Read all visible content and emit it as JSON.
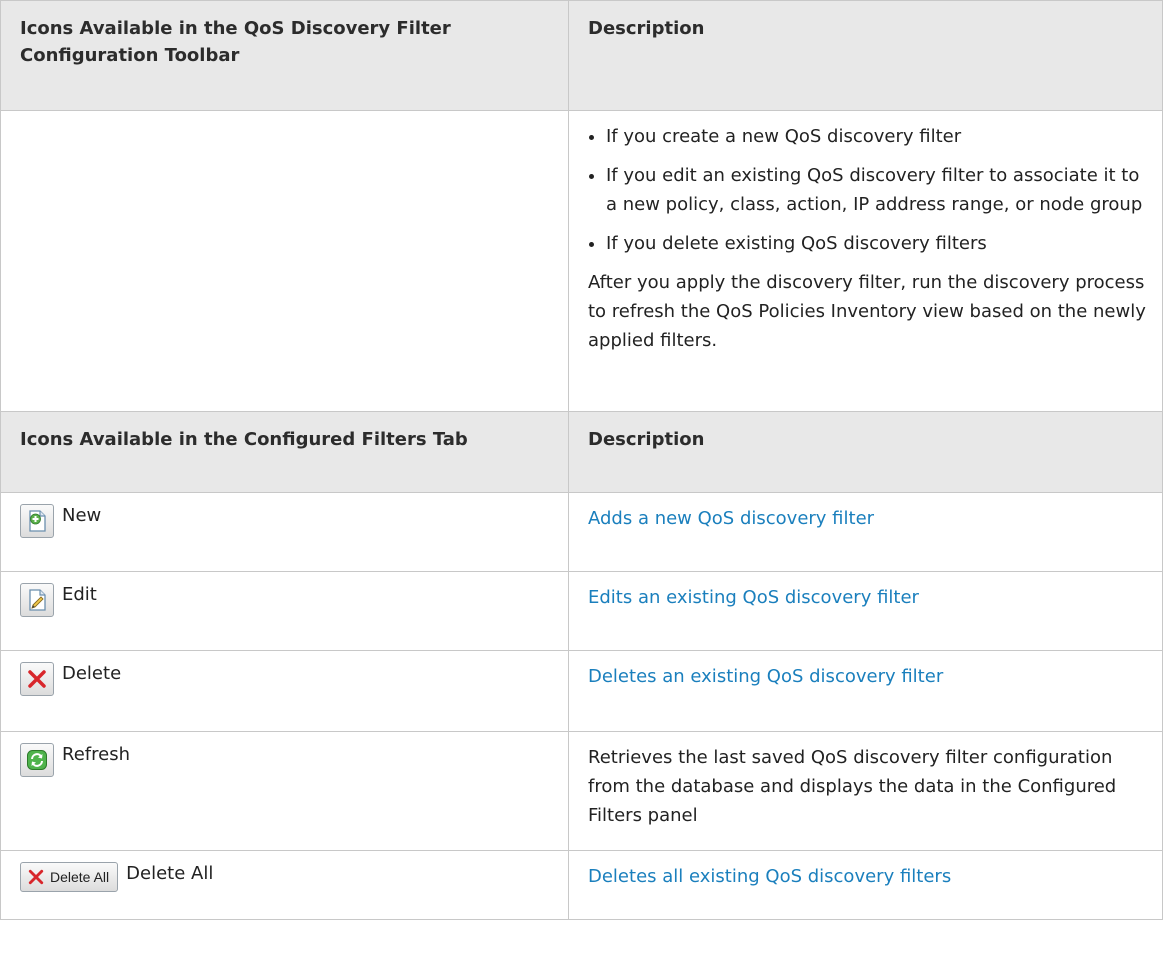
{
  "table1": {
    "header": {
      "col1": "Icons Available in the QoS Discovery Filter Configuration Toolbar",
      "col2": "Description"
    },
    "bullets": [
      "If you create a new QoS discovery filter",
      "If you edit an existing QoS discovery filter to associate it to a new policy, class, action, IP address range, or node group",
      "If you delete existing QoS discovery filters"
    ],
    "paragraph": "After you apply the discovery filter, run the discovery process to refresh the QoS Policies Inventory view based on the newly applied filters."
  },
  "table2": {
    "header": {
      "col1": "Icons Available in the Configured Filters Tab",
      "col2": "Description"
    },
    "rows": [
      {
        "icon": "new-icon",
        "label": "New",
        "description": "Adds a new QoS discovery filter",
        "is_link": true
      },
      {
        "icon": "edit-icon",
        "label": "Edit",
        "description": "Edits an existing QoS discovery filter",
        "is_link": true
      },
      {
        "icon": "delete-icon",
        "label": "Delete",
        "description": "Deletes an existing QoS discovery filter",
        "is_link": true
      },
      {
        "icon": "refresh-icon",
        "label": "Refresh",
        "description": "Retrieves the last saved QoS discovery filter configuration from the database and displays the data in the Configured Filters panel",
        "is_link": false
      },
      {
        "icon": "delete-all-icon",
        "label": "Delete All",
        "button_text": "Delete All",
        "description": "Deletes all existing QoS discovery filters",
        "is_link": true
      }
    ]
  },
  "colors": {
    "link": "#1a7fbd",
    "header_bg": "#e8e8e8",
    "border": "#c8c8c8",
    "delete_red": "#d8262b",
    "refresh_green": "#3aa63a"
  }
}
